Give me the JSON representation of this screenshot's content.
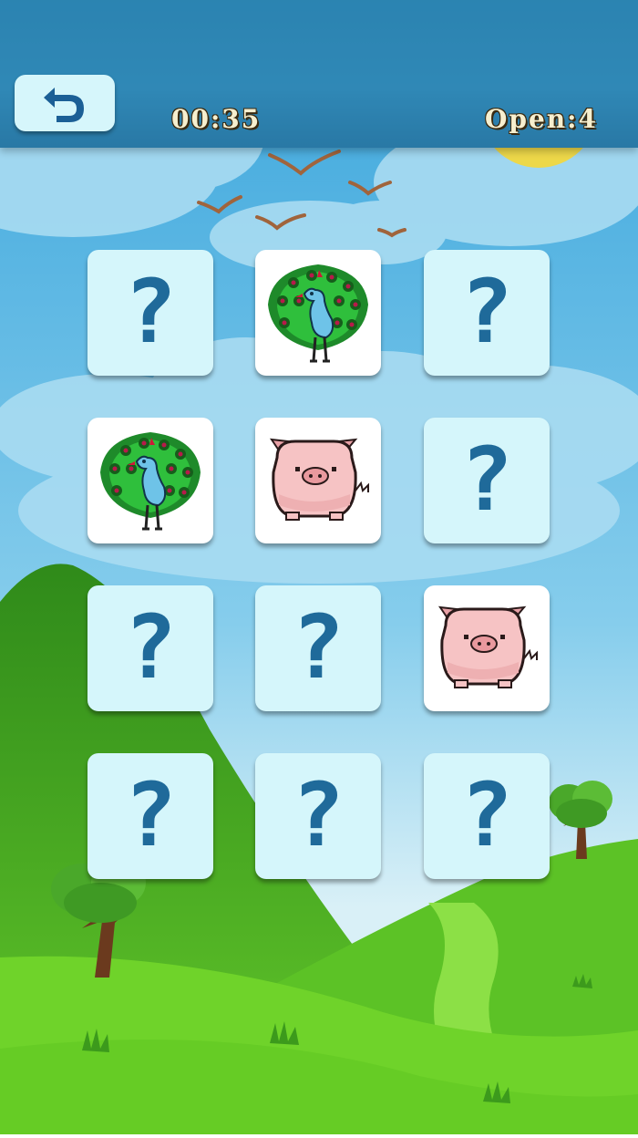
{
  "header": {
    "back_button": {
      "icon": "undo-arrow-icon"
    },
    "timer": "00:35",
    "open_counter": "Open:4"
  },
  "board": {
    "rows": 4,
    "columns": 3,
    "cards": [
      {
        "state": "hidden",
        "label": "?"
      },
      {
        "state": "revealed",
        "animal": "peacock"
      },
      {
        "state": "hidden",
        "label": "?"
      },
      {
        "state": "revealed",
        "animal": "peacock"
      },
      {
        "state": "revealed",
        "animal": "pig"
      },
      {
        "state": "hidden",
        "label": "?"
      },
      {
        "state": "hidden",
        "label": "?"
      },
      {
        "state": "hidden",
        "label": "?"
      },
      {
        "state": "revealed",
        "animal": "pig"
      },
      {
        "state": "hidden",
        "label": "?"
      },
      {
        "state": "hidden",
        "label": "?"
      },
      {
        "state": "hidden",
        "label": "?"
      }
    ]
  },
  "colors": {
    "sky": "#5bb8e6",
    "card_hidden": "#d5f6fb",
    "question_mark": "#1f6a9a",
    "hill_dark": "#3a9a1e",
    "grass": "#6fd32a",
    "sun": "#f3d83b"
  }
}
